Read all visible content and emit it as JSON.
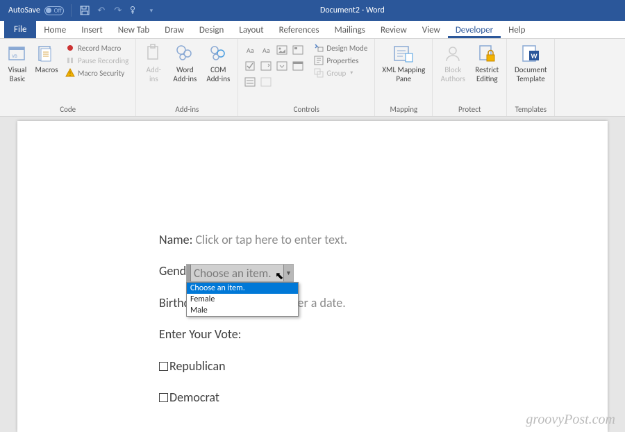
{
  "titlebar": {
    "autosave_label": "AutoSave",
    "autosave_state": "Off",
    "doc_title": "Document2 - Word"
  },
  "tabs": [
    "File",
    "Home",
    "Insert",
    "New Tab",
    "Draw",
    "Design",
    "Layout",
    "References",
    "Mailings",
    "Review",
    "View",
    "Developer",
    "Help"
  ],
  "tabs_active_index": 11,
  "ribbon": {
    "code": {
      "label": "Code",
      "visual_basic": "Visual\nBasic",
      "macros": "Macros",
      "record": "Record Macro",
      "pause": "Pause Recording",
      "security": "Macro Security"
    },
    "addins": {
      "label": "Add-ins",
      "addins": "Add-\nins",
      "word": "Word\nAdd-ins",
      "com": "COM\nAdd-ins"
    },
    "controls": {
      "label": "Controls",
      "design": "Design Mode",
      "props": "Properties",
      "group": "Group"
    },
    "mapping": {
      "label": "Mapping",
      "xml": "XML Mapping\nPane"
    },
    "protect": {
      "label": "Protect",
      "block": "Block\nAuthors",
      "restrict": "Restrict\nEditing"
    },
    "templates": {
      "label": "Templates",
      "doctpl": "Document\nTemplate"
    }
  },
  "form": {
    "name_label": "Name: ",
    "name_placeholder": "Click or tap here to enter text.",
    "gender_label": "Gender:",
    "gender_placeholder": "Choose an item.",
    "gender_options": [
      "Choose an item.",
      "Female",
      "Male"
    ],
    "birthday_label": "Birthday",
    "birthday_placeholder": "ter a date.",
    "vote_label": "Enter Your Vote:",
    "vote_opt1": "Republican",
    "vote_opt2": "Democrat"
  },
  "watermark": "groovyPost.com"
}
